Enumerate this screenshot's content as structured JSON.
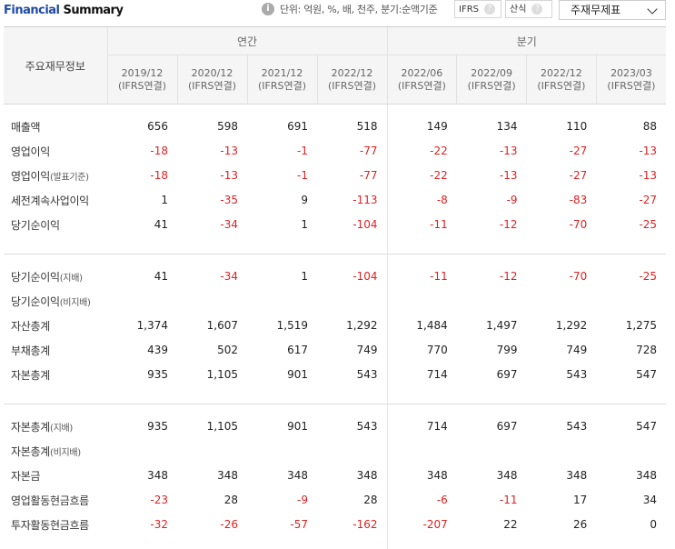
{
  "header": {
    "title_a": "Financial",
    "title_b": "Summary",
    "info_icon": "i",
    "unit_text": "단위: 억원, %, 배, 천주, 분기:순액기준",
    "toggle_ifrs": "IFRS",
    "toggle_calc": "산식",
    "help_glyph": "?",
    "select_value": "주재무제표"
  },
  "table": {
    "row_header_label": "주요재무정보",
    "groups": {
      "annual": "연간",
      "quarter": "분기"
    },
    "columns": [
      {
        "period": "2019/12",
        "basis": "(IFRS연결)"
      },
      {
        "period": "2020/12",
        "basis": "(IFRS연결)"
      },
      {
        "period": "2021/12",
        "basis": "(IFRS연결)"
      },
      {
        "period": "2022/12",
        "basis": "(IFRS연결)"
      },
      {
        "period": "2022/06",
        "basis": "(IFRS연결)"
      },
      {
        "period": "2022/09",
        "basis": "(IFRS연결)"
      },
      {
        "period": "2022/12",
        "basis": "(IFRS연결)"
      },
      {
        "period": "2023/03",
        "basis": "(IFRS연결)"
      }
    ],
    "sections": [
      [
        {
          "label": "매출액",
          "sub": "",
          "values": [
            "656",
            "598",
            "691",
            "518",
            "149",
            "134",
            "110",
            "88"
          ]
        },
        {
          "label": "영업이익",
          "sub": "",
          "values": [
            "-18",
            "-13",
            "-1",
            "-77",
            "-22",
            "-13",
            "-27",
            "-13"
          ]
        },
        {
          "label": "영업이익",
          "sub": "(발표기준)",
          "values": [
            "-18",
            "-13",
            "-1",
            "-77",
            "-22",
            "-13",
            "-27",
            "-13"
          ]
        },
        {
          "label": "세전계속사업이익",
          "sub": "",
          "values": [
            "1",
            "-35",
            "9",
            "-113",
            "-8",
            "-9",
            "-83",
            "-27"
          ]
        },
        {
          "label": "당기순이익",
          "sub": "",
          "values": [
            "41",
            "-34",
            "1",
            "-104",
            "-11",
            "-12",
            "-70",
            "-25"
          ]
        }
      ],
      [
        {
          "label": "당기순이익",
          "sub": "(지배)",
          "values": [
            "41",
            "-34",
            "1",
            "-104",
            "-11",
            "-12",
            "-70",
            "-25"
          ]
        },
        {
          "label": "당기순이익",
          "sub": "(비지배)",
          "values": [
            "",
            "",
            "",
            "",
            "",
            "",
            "",
            ""
          ]
        },
        {
          "label": "자산총계",
          "sub": "",
          "values": [
            "1,374",
            "1,607",
            "1,519",
            "1,292",
            "1,484",
            "1,497",
            "1,292",
            "1,275"
          ]
        },
        {
          "label": "부채총계",
          "sub": "",
          "values": [
            "439",
            "502",
            "617",
            "749",
            "770",
            "799",
            "749",
            "728"
          ]
        },
        {
          "label": "자본총계",
          "sub": "",
          "values": [
            "935",
            "1,105",
            "901",
            "543",
            "714",
            "697",
            "543",
            "547"
          ]
        }
      ],
      [
        {
          "label": "자본총계",
          "sub": "(지배)",
          "values": [
            "935",
            "1,105",
            "901",
            "543",
            "714",
            "697",
            "543",
            "547"
          ]
        },
        {
          "label": "자본총계",
          "sub": "(비지배)",
          "values": [
            "",
            "",
            "",
            "",
            "",
            "",
            "",
            ""
          ]
        },
        {
          "label": "자본금",
          "sub": "",
          "values": [
            "348",
            "348",
            "348",
            "348",
            "348",
            "348",
            "348",
            "348"
          ]
        },
        {
          "label": "영업활동현금흐름",
          "sub": "",
          "values": [
            "-23",
            "28",
            "-9",
            "28",
            "-6",
            "-11",
            "17",
            "34"
          ]
        },
        {
          "label": "투자활동현금흐름",
          "sub": "",
          "values": [
            "-32",
            "-26",
            "-57",
            "-162",
            "-207",
            "22",
            "26",
            "0"
          ]
        }
      ]
    ]
  },
  "colors": {
    "negative": "#e02222",
    "brand_blue": "#1f4aa8"
  }
}
